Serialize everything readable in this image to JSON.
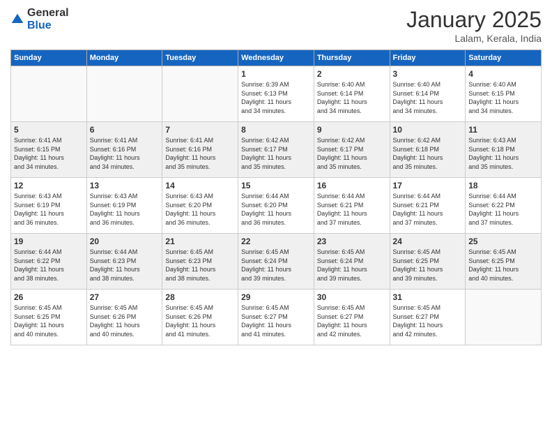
{
  "header": {
    "logo_general": "General",
    "logo_blue": "Blue",
    "month_title": "January 2025",
    "location": "Lalam, Kerala, India"
  },
  "weekdays": [
    "Sunday",
    "Monday",
    "Tuesday",
    "Wednesday",
    "Thursday",
    "Friday",
    "Saturday"
  ],
  "weeks": [
    [
      {
        "day": "",
        "info": ""
      },
      {
        "day": "",
        "info": ""
      },
      {
        "day": "",
        "info": ""
      },
      {
        "day": "1",
        "info": "Sunrise: 6:39 AM\nSunset: 6:13 PM\nDaylight: 11 hours\nand 34 minutes."
      },
      {
        "day": "2",
        "info": "Sunrise: 6:40 AM\nSunset: 6:14 PM\nDaylight: 11 hours\nand 34 minutes."
      },
      {
        "day": "3",
        "info": "Sunrise: 6:40 AM\nSunset: 6:14 PM\nDaylight: 11 hours\nand 34 minutes."
      },
      {
        "day": "4",
        "info": "Sunrise: 6:40 AM\nSunset: 6:15 PM\nDaylight: 11 hours\nand 34 minutes."
      }
    ],
    [
      {
        "day": "5",
        "info": "Sunrise: 6:41 AM\nSunset: 6:15 PM\nDaylight: 11 hours\nand 34 minutes."
      },
      {
        "day": "6",
        "info": "Sunrise: 6:41 AM\nSunset: 6:16 PM\nDaylight: 11 hours\nand 34 minutes."
      },
      {
        "day": "7",
        "info": "Sunrise: 6:41 AM\nSunset: 6:16 PM\nDaylight: 11 hours\nand 35 minutes."
      },
      {
        "day": "8",
        "info": "Sunrise: 6:42 AM\nSunset: 6:17 PM\nDaylight: 11 hours\nand 35 minutes."
      },
      {
        "day": "9",
        "info": "Sunrise: 6:42 AM\nSunset: 6:17 PM\nDaylight: 11 hours\nand 35 minutes."
      },
      {
        "day": "10",
        "info": "Sunrise: 6:42 AM\nSunset: 6:18 PM\nDaylight: 11 hours\nand 35 minutes."
      },
      {
        "day": "11",
        "info": "Sunrise: 6:43 AM\nSunset: 6:18 PM\nDaylight: 11 hours\nand 35 minutes."
      }
    ],
    [
      {
        "day": "12",
        "info": "Sunrise: 6:43 AM\nSunset: 6:19 PM\nDaylight: 11 hours\nand 36 minutes."
      },
      {
        "day": "13",
        "info": "Sunrise: 6:43 AM\nSunset: 6:19 PM\nDaylight: 11 hours\nand 36 minutes."
      },
      {
        "day": "14",
        "info": "Sunrise: 6:43 AM\nSunset: 6:20 PM\nDaylight: 11 hours\nand 36 minutes."
      },
      {
        "day": "15",
        "info": "Sunrise: 6:44 AM\nSunset: 6:20 PM\nDaylight: 11 hours\nand 36 minutes."
      },
      {
        "day": "16",
        "info": "Sunrise: 6:44 AM\nSunset: 6:21 PM\nDaylight: 11 hours\nand 37 minutes."
      },
      {
        "day": "17",
        "info": "Sunrise: 6:44 AM\nSunset: 6:21 PM\nDaylight: 11 hours\nand 37 minutes."
      },
      {
        "day": "18",
        "info": "Sunrise: 6:44 AM\nSunset: 6:22 PM\nDaylight: 11 hours\nand 37 minutes."
      }
    ],
    [
      {
        "day": "19",
        "info": "Sunrise: 6:44 AM\nSunset: 6:22 PM\nDaylight: 11 hours\nand 38 minutes."
      },
      {
        "day": "20",
        "info": "Sunrise: 6:44 AM\nSunset: 6:23 PM\nDaylight: 11 hours\nand 38 minutes."
      },
      {
        "day": "21",
        "info": "Sunrise: 6:45 AM\nSunset: 6:23 PM\nDaylight: 11 hours\nand 38 minutes."
      },
      {
        "day": "22",
        "info": "Sunrise: 6:45 AM\nSunset: 6:24 PM\nDaylight: 11 hours\nand 39 minutes."
      },
      {
        "day": "23",
        "info": "Sunrise: 6:45 AM\nSunset: 6:24 PM\nDaylight: 11 hours\nand 39 minutes."
      },
      {
        "day": "24",
        "info": "Sunrise: 6:45 AM\nSunset: 6:25 PM\nDaylight: 11 hours\nand 39 minutes."
      },
      {
        "day": "25",
        "info": "Sunrise: 6:45 AM\nSunset: 6:25 PM\nDaylight: 11 hours\nand 40 minutes."
      }
    ],
    [
      {
        "day": "26",
        "info": "Sunrise: 6:45 AM\nSunset: 6:25 PM\nDaylight: 11 hours\nand 40 minutes."
      },
      {
        "day": "27",
        "info": "Sunrise: 6:45 AM\nSunset: 6:26 PM\nDaylight: 11 hours\nand 40 minutes."
      },
      {
        "day": "28",
        "info": "Sunrise: 6:45 AM\nSunset: 6:26 PM\nDaylight: 11 hours\nand 41 minutes."
      },
      {
        "day": "29",
        "info": "Sunrise: 6:45 AM\nSunset: 6:27 PM\nDaylight: 11 hours\nand 41 minutes."
      },
      {
        "day": "30",
        "info": "Sunrise: 6:45 AM\nSunset: 6:27 PM\nDaylight: 11 hours\nand 42 minutes."
      },
      {
        "day": "31",
        "info": "Sunrise: 6:45 AM\nSunset: 6:27 PM\nDaylight: 11 hours\nand 42 minutes."
      },
      {
        "day": "",
        "info": ""
      }
    ]
  ]
}
